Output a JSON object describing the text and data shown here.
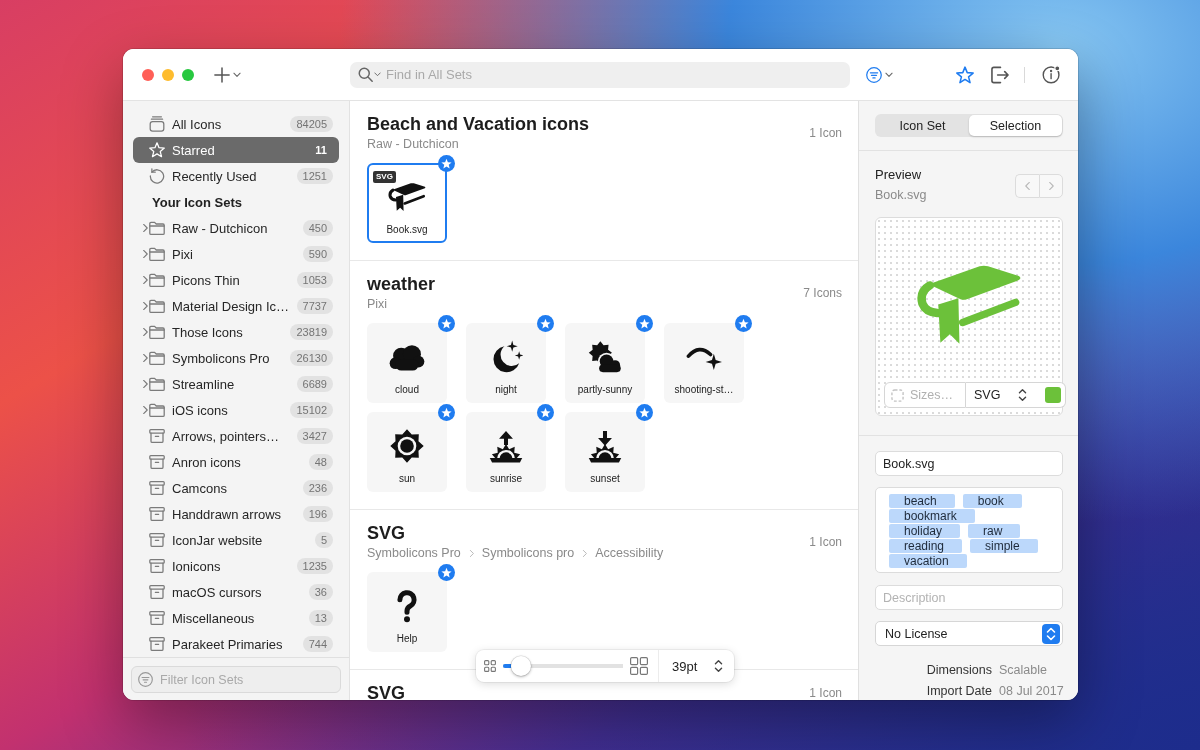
{
  "toolbar": {
    "search": {
      "placeholder": "Find in All Sets"
    }
  },
  "sidebar": {
    "items": [
      {
        "kind": "all",
        "label": "All Icons",
        "count": "84205",
        "selected": false
      },
      {
        "kind": "starred",
        "label": "Starred",
        "count": "11",
        "selected": true
      },
      {
        "kind": "recent",
        "label": "Recently Used",
        "count": "1251",
        "selected": false
      }
    ],
    "heading": "Your Icon Sets",
    "sets": [
      {
        "kind": "folder",
        "label": "Raw - Dutchicon",
        "count": "450",
        "selected": false
      },
      {
        "kind": "folder",
        "label": "Pixi",
        "count": "590",
        "selected": false
      },
      {
        "kind": "folder",
        "label": "Picons Thin",
        "count": "1053",
        "selected": false
      },
      {
        "kind": "folder",
        "label": "Material Design Ic…",
        "count": "7737",
        "selected": false
      },
      {
        "kind": "folder",
        "label": "Those Icons",
        "count": "23819",
        "selected": false
      },
      {
        "kind": "folder",
        "label": "Symbolicons Pro",
        "count": "26130",
        "selected": false
      },
      {
        "kind": "folder",
        "label": "Streamline",
        "count": "6689",
        "selected": false
      },
      {
        "kind": "folder",
        "label": "iOS icons",
        "count": "15102",
        "selected": false
      },
      {
        "kind": "archive",
        "label": "Arrows, pointers…",
        "count": "3427",
        "selected": false
      },
      {
        "kind": "archive",
        "label": "Anron icons",
        "count": "48",
        "selected": false
      },
      {
        "kind": "archive",
        "label": "Camcons",
        "count": "236",
        "selected": false
      },
      {
        "kind": "archive",
        "label": "Handdrawn arrows",
        "count": "196",
        "selected": false
      },
      {
        "kind": "archive",
        "label": "IconJar website",
        "count": "5",
        "selected": false
      },
      {
        "kind": "archive",
        "label": "Ionicons",
        "count": "1235",
        "selected": false
      },
      {
        "kind": "archive",
        "label": "macOS cursors",
        "count": "36",
        "selected": false
      },
      {
        "kind": "archive",
        "label": "Miscellaneous",
        "count": "13",
        "selected": false
      },
      {
        "kind": "archive",
        "label": "Parakeet Primaries",
        "count": "744",
        "selected": false
      }
    ],
    "filter": {
      "placeholder": "Filter Icon Sets"
    }
  },
  "sections": [
    {
      "title": "Beach and Vacation icons",
      "path": [
        "Raw - Dutchicon"
      ],
      "count": "1 Icon",
      "icons": [
        {
          "label": "Book.svg",
          "kind": "book",
          "badge": "SVG",
          "selected": true,
          "starred": true
        }
      ]
    },
    {
      "title": "weather",
      "path": [
        "Pixi"
      ],
      "count": "7 Icons",
      "icons": [
        {
          "label": "cloud",
          "kind": "cloud",
          "selected": false,
          "starred": true
        },
        {
          "label": "night",
          "kind": "moon",
          "selected": false,
          "starred": true
        },
        {
          "label": "partly-sunny",
          "kind": "sun-cloud",
          "selected": false,
          "starred": true
        },
        {
          "label": "shooting-st…",
          "kind": "shooting-star",
          "selected": false,
          "starred": true
        },
        {
          "label": "sun",
          "kind": "sun",
          "selected": false,
          "starred": true
        },
        {
          "label": "sunrise",
          "kind": "sunrise",
          "selected": false,
          "starred": true
        },
        {
          "label": "sunset",
          "kind": "sunset",
          "selected": false,
          "starred": true
        }
      ]
    },
    {
      "title": "SVG",
      "path": [
        "Symbolicons Pro",
        "Symbolicons pro",
        "Accessibility"
      ],
      "count": "1 Icon",
      "icons": [
        {
          "label": "Help",
          "kind": "question",
          "selected": false,
          "starred": true
        }
      ]
    },
    {
      "title": "SVG",
      "count": "1 Icon"
    }
  ],
  "zoom": {
    "level": 0.08,
    "size": "39pt"
  },
  "inspector": {
    "tabs": [
      {
        "label": "Icon Set",
        "selected": false
      },
      {
        "label": "Selection",
        "selected": true
      }
    ],
    "preview": {
      "title": "Preview",
      "file": "Book.svg",
      "kind": "book",
      "sizes_placeholder": "Sizes…",
      "format": "SVG"
    },
    "name": {
      "value": "Book.svg"
    },
    "tags": [
      "beach",
      "book",
      "bookmark",
      "holiday",
      "raw",
      "reading",
      "simple",
      "vacation"
    ],
    "description": {
      "placeholder": "Description"
    },
    "license": {
      "value": "No License"
    },
    "info": [
      {
        "label": "Dimensions",
        "value": "Scalable"
      },
      {
        "label": "Import Date",
        "value": "08 Jul 2017"
      }
    ]
  }
}
